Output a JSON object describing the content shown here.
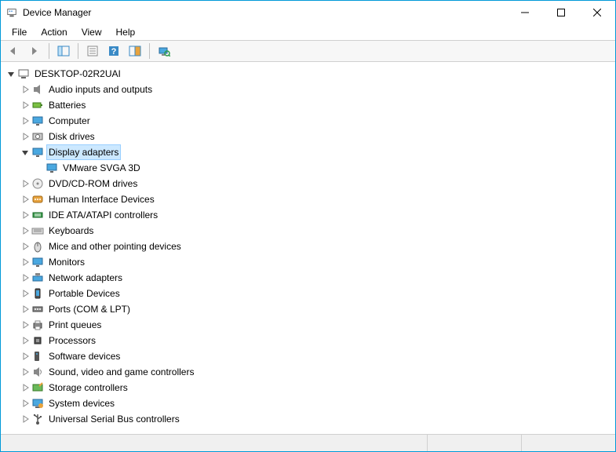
{
  "window": {
    "title": "Device Manager"
  },
  "menubar": {
    "file": "File",
    "action": "Action",
    "view": "View",
    "help": "Help"
  },
  "toolbar": {
    "back": "back",
    "forward": "forward",
    "show_hide_tree": "show-hide-tree",
    "properties": "properties",
    "help": "help",
    "action_center": "action-center",
    "scan": "scan-hardware"
  },
  "tree": {
    "root": {
      "label": "DESKTOP-02R2UAI",
      "expanded": true,
      "icon": "pc"
    },
    "nodes": [
      {
        "label": "Audio inputs and outputs",
        "icon": "audio",
        "expanded": false
      },
      {
        "label": "Batteries",
        "icon": "battery",
        "expanded": false
      },
      {
        "label": "Computer",
        "icon": "monitor",
        "expanded": false
      },
      {
        "label": "Disk drives",
        "icon": "disk",
        "expanded": false
      },
      {
        "label": "Display adapters",
        "icon": "monitor",
        "expanded": true,
        "selected": true,
        "children": [
          {
            "label": "VMware SVGA 3D",
            "icon": "monitor"
          }
        ]
      },
      {
        "label": "DVD/CD-ROM drives",
        "icon": "dvd",
        "expanded": false
      },
      {
        "label": "Human Interface Devices",
        "icon": "hid",
        "expanded": false
      },
      {
        "label": "IDE ATA/ATAPI controllers",
        "icon": "ide",
        "expanded": false
      },
      {
        "label": "Keyboards",
        "icon": "keyboard",
        "expanded": false
      },
      {
        "label": "Mice and other pointing devices",
        "icon": "mouse",
        "expanded": false
      },
      {
        "label": "Monitors",
        "icon": "monitor",
        "expanded": false
      },
      {
        "label": "Network adapters",
        "icon": "network",
        "expanded": false
      },
      {
        "label": "Portable Devices",
        "icon": "portable",
        "expanded": false
      },
      {
        "label": "Ports (COM & LPT)",
        "icon": "port",
        "expanded": false
      },
      {
        "label": "Print queues",
        "icon": "printer",
        "expanded": false
      },
      {
        "label": "Processors",
        "icon": "cpu",
        "expanded": false
      },
      {
        "label": "Software devices",
        "icon": "software",
        "expanded": false
      },
      {
        "label": "Sound, video and game controllers",
        "icon": "sound",
        "expanded": false
      },
      {
        "label": "Storage controllers",
        "icon": "storage",
        "expanded": false
      },
      {
        "label": "System devices",
        "icon": "system",
        "expanded": false
      },
      {
        "label": "Universal Serial Bus controllers",
        "icon": "usb",
        "expanded": false
      }
    ]
  }
}
